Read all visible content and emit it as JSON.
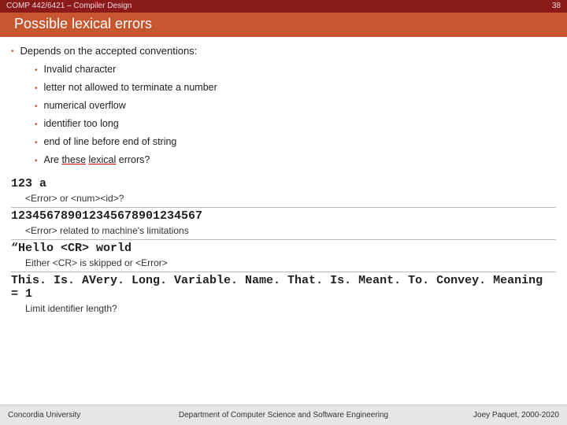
{
  "header": {
    "course": "COMP 442/6421 – Compiler Design",
    "page_number": "38",
    "title": "Possible lexical errors"
  },
  "main_bullet": "Depends on the accepted conventions:",
  "sub_bullets": [
    "Invalid character",
    "letter not allowed to terminate a number",
    "numerical overflow",
    "identifier too long",
    "end of line before end of string"
  ],
  "question_bullet": {
    "prefix": "Are ",
    "word1": "these",
    "mid": " ",
    "word2": "lexical",
    "suffix": " errors?"
  },
  "examples": [
    {
      "code": "123 a",
      "note": "<Error> or <num><id>?"
    },
    {
      "code": "123456789012345678901234567",
      "note": "<Error> related to machine's limitations"
    },
    {
      "code": "“Hello <CR> world",
      "note": "Either <CR> is skipped or <Error>"
    },
    {
      "code": "This. Is. AVery. Long. Variable. Name. That. Is. Meant. To. Convey. Meaning = 1",
      "note": "Limit identifier length?"
    }
  ],
  "footer": {
    "left": "Concordia University",
    "center": "Department of Computer Science and Software Engineering",
    "right": "Joey Paquet, 2000-2020"
  }
}
